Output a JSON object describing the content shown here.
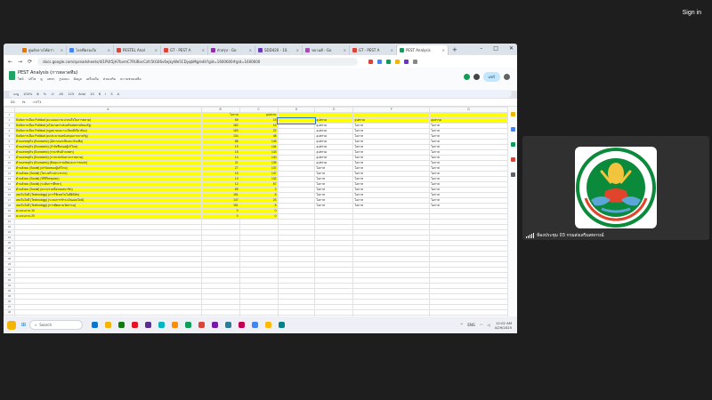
{
  "meeting": {
    "sign_in": "Sign in",
    "participant_name": "ห้องประชุม 03 กรมส่งเสริมสหกรณ์"
  },
  "browser": {
    "tabs": [
      {
        "label": "ศูนย์กลางโค้ดว่า",
        "color": "#e37400"
      },
      {
        "label": "โลกที่ครองใจ",
        "color": "#4285f4"
      },
      {
        "label": "PESTEL Anal",
        "color": "#db4437"
      },
      {
        "label": "GT - PEST A",
        "color": "#db4437"
      },
      {
        "label": "ตัวสรุป - Go",
        "color": "#9c27b0"
      },
      {
        "label": "SDD420 - 10.",
        "color": "#673ab7"
      },
      {
        "label": "ขบวนดี - Go",
        "color": "#ab47bc"
      },
      {
        "label": "GT - PEST A",
        "color": "#db4437"
      },
      {
        "label": "PEST Analysis",
        "color": "#0f9d58"
      }
    ],
    "new_tab": "+",
    "url": "docs.google.com/spreadsheets/d/1PUt5jH7bvmC7RUBvcCzfc5tG06v6ejkyWe5CDyqbMg/edit?gid=1600600#gid=1600600"
  },
  "sheet": {
    "title": "PEST Analysis (การตลาดทีม)",
    "menus": [
      "ไฟล์",
      "แก้ไข",
      "ดู",
      "แทรก",
      "รูปแบบ",
      "ข้อมูล",
      "เครื่องมือ",
      "ส่วนเสริม",
      "ความช่วยเหลือ"
    ],
    "share_label": "แชร์",
    "toolbar": [
      "เมนู",
      "100%",
      "฿",
      "%",
      ".0",
      ".00",
      "123",
      "Arial",
      "10",
      "B",
      "I",
      "S",
      "A"
    ],
    "cell_ref": "D1",
    "formula": "=VT1",
    "columns": [
      "A",
      "B",
      "C",
      "D",
      "E",
      "F",
      "G"
    ],
    "header_row": [
      "",
      "โอกาส",
      "อุปสรรค",
      "",
      "",
      "",
      ""
    ],
    "rows": [
      [
        "ปัจจัยการเมือง Political (คะแนนความน่าสนใจในการตลาด)",
        "69",
        "15",
        "-",
        "อุปสรรค",
        "อุปสรรค",
        "อุปสรรค"
      ],
      [
        "ปัจจัยการเมือง Political (นโยบายการส่งเสริมสหกรณ์ของรัฐ)",
        "182",
        "16",
        "",
        "อุปสรรค",
        "โอกาส",
        "โอกาส"
      ],
      [
        "ปัจจัยการเมือง Political (กฎหมายและระเบียบที่เกี่ยวข้อง)",
        "163",
        "22",
        "",
        "อุปสรรค",
        "โอกาส",
        "โอกาส"
      ],
      [
        "ปัจจัยการเมือง Political (งบประมาณสนับสนุนจากภาครัฐ)",
        "134",
        "48",
        "",
        "อุปสรรค",
        "โอกาส",
        "โอกาส"
      ],
      [
        "ด้านเศรษฐกิจ (Economic) (อัตราดอกเบี้ยและเงินเฟ้อ)",
        "88",
        "145",
        "",
        "อุปสรรค",
        "โอกาส",
        "โอกาส"
      ],
      [
        "ด้านเศรษฐกิจ (Economic) (กำลังซื้อของผู้บริโภค)",
        "19",
        "144",
        "",
        "อุปสรรค",
        "โอกาส",
        "โอกาส"
      ],
      [
        "ด้านเศรษฐกิจ (Economic) (ราคาสินค้าเกษตร)",
        "15",
        "143",
        "",
        "อุปสรรค",
        "โอกาส",
        "โอกาส"
      ],
      [
        "ด้านเศรษฐกิจ (Economic) (การแข่งขันทางการตลาด)",
        "14",
        "140",
        "",
        "อุปสรรค",
        "โอกาส",
        "โอกาส"
      ],
      [
        "ด้านเศรษฐกิจ (Economic) (ต้นทุนการผลิตและการขนส่ง)",
        "21",
        "139",
        "",
        "อุปสรรค",
        "โอกาส",
        "โอกาส"
      ],
      [
        "ด้านสังคม (Social) (ค่านิยมของผู้บริโภค)",
        "27",
        "137",
        "",
        "โอกาส",
        "โอกาส",
        "โอกาส"
      ],
      [
        "ด้านสังคม (Social) (โครงสร้างประชากร)",
        "15",
        "147",
        "",
        "โอกาส",
        "โอกาส",
        "โอกาส"
      ],
      [
        "ด้านสังคม (Social) (วิถีชีวิตชุมชน)",
        "13",
        "132",
        "",
        "โอกาส",
        "โอกาส",
        "โอกาส"
      ],
      [
        "ด้านสังคม (Social) (ระดับการศึกษา)",
        "12",
        "67",
        "",
        "โอกาส",
        "โอกาส",
        "โอกาส"
      ],
      [
        "ด้านสังคม (Social) (ความร่วมมือของสมาชิก)",
        "89",
        "3",
        "",
        "โอกาส",
        "โอกาส",
        "โอกาส"
      ],
      [
        "เทคโนโลยี (Technology) (การใช้เทคโนโลยีดิจิทัล)",
        "151",
        "8",
        "",
        "โอกาส",
        "โอกาส",
        "โอกาส"
      ],
      [
        "เทคโนโลยี (Technology) (ระบบการชำระเงินออนไลน์)",
        "147",
        "23",
        "",
        "โอกาส",
        "โอกาส",
        "โอกาส"
      ],
      [
        "เทคโนโลยี (Technology) (การพัฒนานวัตกรรม)",
        "151",
        "8",
        "",
        "โอกาส",
        "โอกาส",
        "โอกาส"
      ],
      [
        "คะแนนรวม 10",
        "0",
        "0",
        "",
        "",
        "",
        ""
      ],
      [
        "คะแนนรวม 20",
        "0",
        "0",
        "",
        "",
        "",
        ""
      ]
    ],
    "empty_row_count": 19,
    "sheet_tabs": [
      "การตลาดแบบดิจิทัล",
      "ชีท1"
    ]
  },
  "taskbar": {
    "search_placeholder": "Search",
    "lang": "ENG",
    "time": "12:02 AM",
    "date": "4/29/2025",
    "app_colors": [
      "#0078d4",
      "#f4b400",
      "#107c10",
      "#e81123",
      "#5c2d91",
      "#00b7c3",
      "#ff8c00",
      "#0f9d58",
      "#db4437",
      "#7719aa",
      "#2d7d9a",
      "#c30052",
      "#4285f4",
      "#ffb900",
      "#038387"
    ]
  },
  "colors": {
    "highlight": "#ffff00",
    "sheets_green": "#1fa463",
    "logo_green": "#0a8a3a"
  }
}
